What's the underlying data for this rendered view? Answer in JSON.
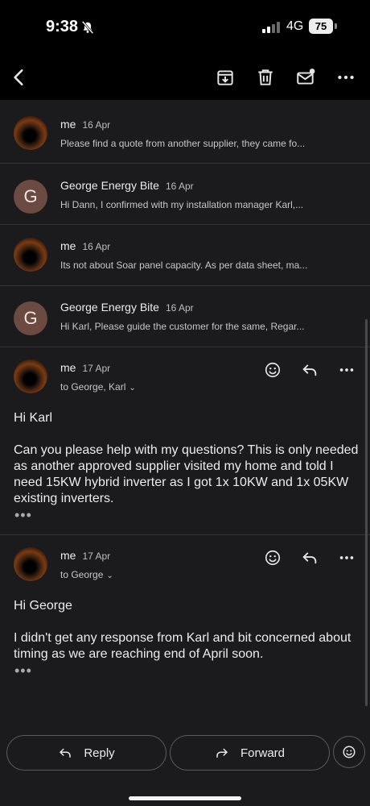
{
  "status_bar": {
    "time": "9:38",
    "network": "4G",
    "battery": "75"
  },
  "toolbar": {
    "back": "back",
    "archive": "archive",
    "delete": "delete",
    "mark_unread": "mark unread",
    "more": "more"
  },
  "collapsed": [
    {
      "sender": "me",
      "date": "16 Apr",
      "snippet": "Please find a quote from another supplier, they came fo...",
      "avatar": "image"
    },
    {
      "sender": "George Energy Bite",
      "date": "16 Apr",
      "snippet": "Hi Dann, I confirmed with my installation manager Karl,...",
      "avatar": "G"
    },
    {
      "sender": "me",
      "date": "16 Apr",
      "snippet": "Its not about Soar panel capacity. As per data sheet, ma...",
      "avatar": "image"
    },
    {
      "sender": "George Energy Bite",
      "date": "16 Apr",
      "snippet": "Hi Karl, Please guide the customer for the same, Regar...",
      "avatar": "G"
    }
  ],
  "expanded": [
    {
      "sender": "me",
      "date": "17 Apr",
      "to": "to George, Karl",
      "greeting": "Hi Karl",
      "paragraph": "Can you please help with my questions? This is only needed as another approved supplier visited my home and told I need 15KW hybrid inverter as I got 1x 10KW and 1x 05KW existing inverters.",
      "trimmed": "•••"
    },
    {
      "sender": "me",
      "date": "17 Apr",
      "to": "to George",
      "greeting": "Hi George",
      "paragraph": "I didn't get any response from Karl and bit concerned about timing as we are reaching end of April soon.",
      "trimmed": "•••"
    }
  ],
  "actions": {
    "reply": "Reply",
    "forward": "Forward"
  }
}
